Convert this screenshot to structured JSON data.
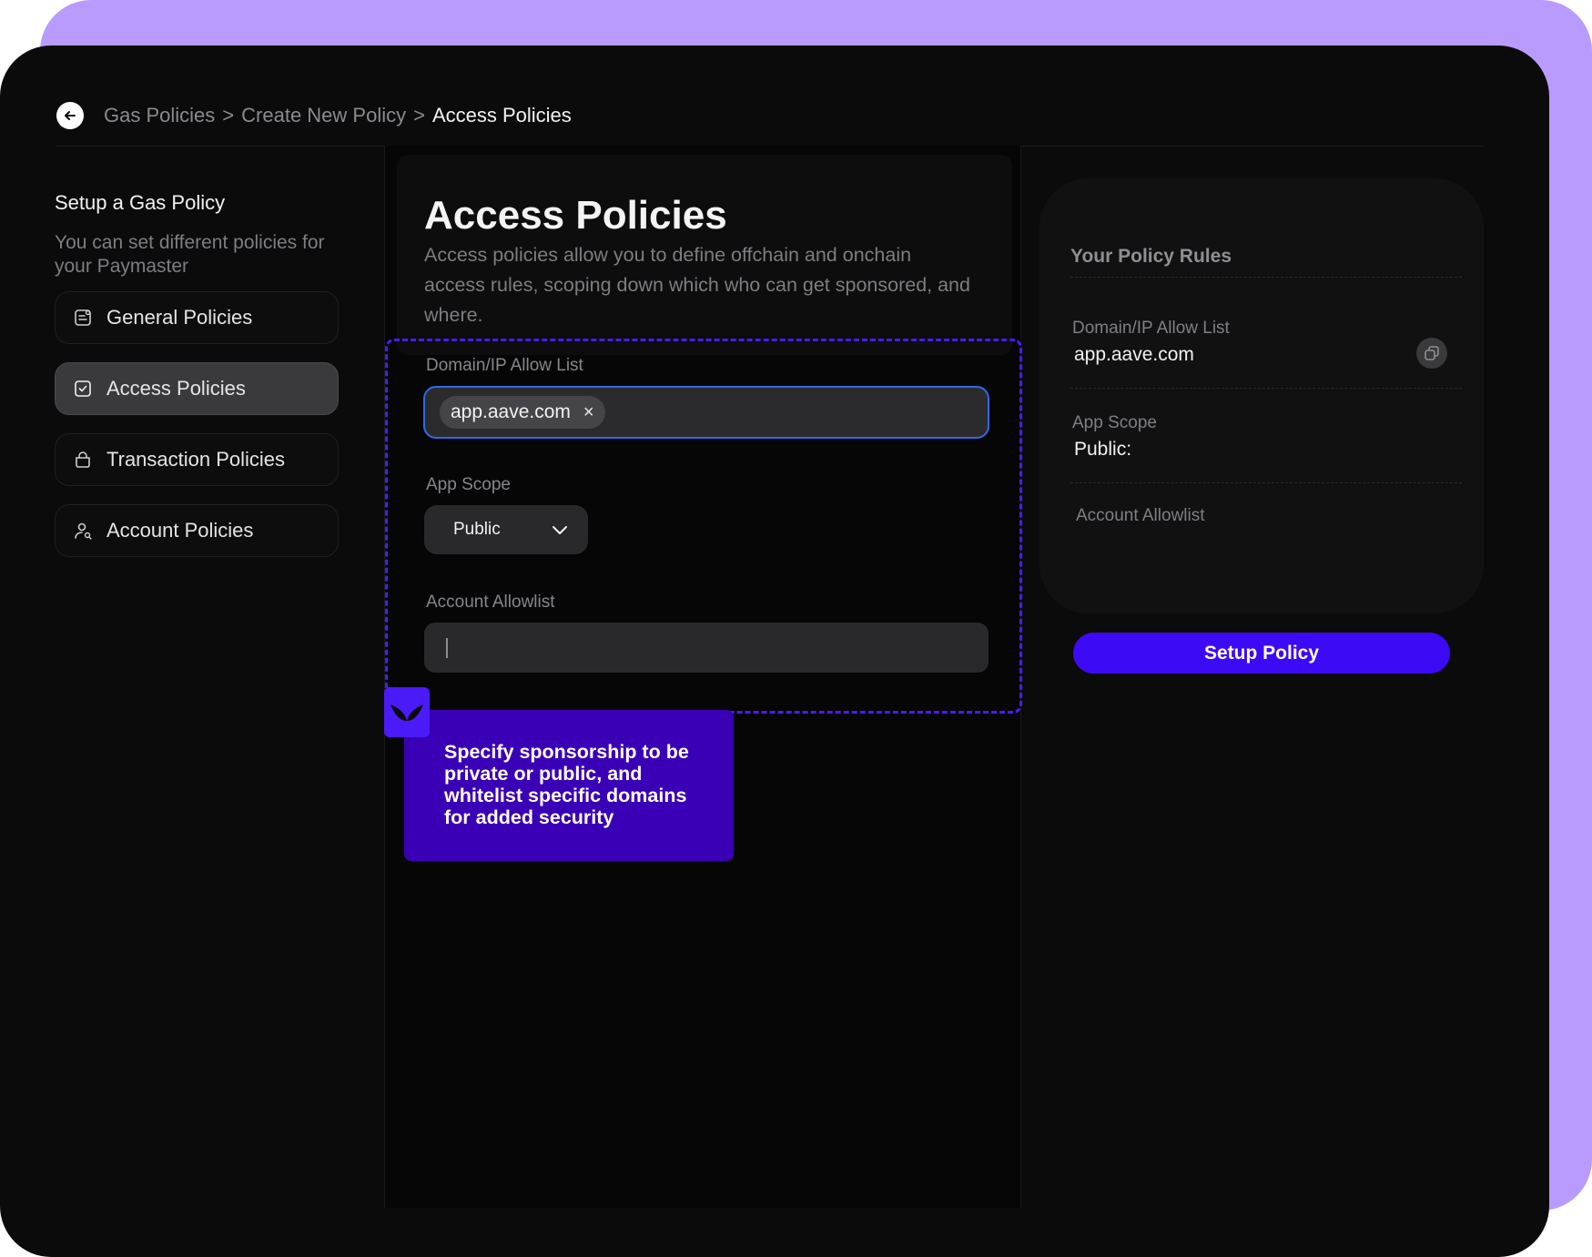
{
  "colors": {
    "accent": "#3d0af5",
    "accent_dashed": "#4a1bf7",
    "tooltip_bg": "#3a00b5",
    "frame_purple": "#b89bfc",
    "focus_border": "#2e6be6"
  },
  "breadcrumb": {
    "items": [
      "Gas Policies",
      "Create New Policy",
      "Access Policies"
    ],
    "separator": ">"
  },
  "sidebar": {
    "title": "Setup a Gas Policy",
    "subtitle": "You can set different policies for your Paymaster",
    "items": [
      {
        "label": "General Policies",
        "icon": "general-policy-icon",
        "active": false
      },
      {
        "label": "Access Policies",
        "icon": "check-square-icon",
        "active": true
      },
      {
        "label": "Transaction Policies",
        "icon": "bag-icon",
        "active": false
      },
      {
        "label": "Account Policies",
        "icon": "user-icon",
        "active": false
      }
    ]
  },
  "main": {
    "title": "Access Policies",
    "description": "Access policies allow you to define offchain and onchain access rules, scoping down which who can get sponsored, and where.",
    "domain_field": {
      "label": "Domain/IP Allow List",
      "tags": [
        "app.aave.com"
      ],
      "remove_glyph": "×"
    },
    "scope_field": {
      "label": "App Scope",
      "selected": "Public"
    },
    "allowlist_field": {
      "label": "Account Allowlist",
      "value": ""
    }
  },
  "tooltip": {
    "text": "Specify sponsorship to be private or public, and whitelist specific domains for added security",
    "icon": "leaf-icon"
  },
  "rules": {
    "title": "Your Policy Rules",
    "domain_label": "Domain/IP Allow List",
    "domain_value": "app.aave.com",
    "scope_label": "App Scope",
    "scope_value": "Public:",
    "allowlist_label": "Account Allowlist"
  },
  "actions": {
    "setup_label": "Setup Policy"
  }
}
